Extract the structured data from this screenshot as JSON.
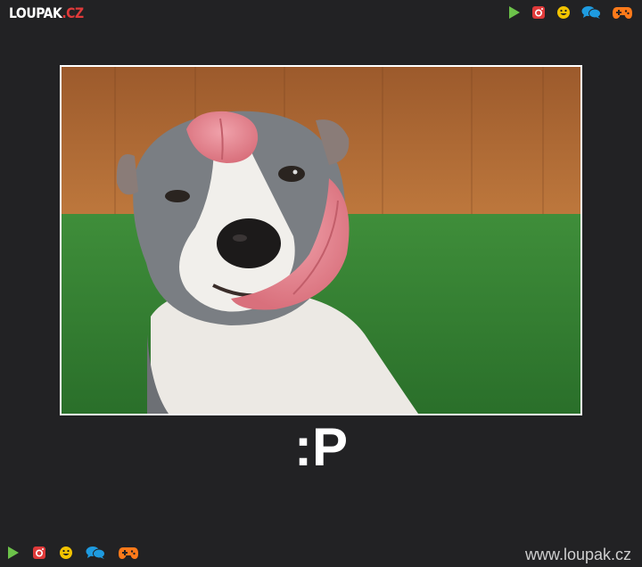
{
  "header": {
    "logo_main": "LOUPAK",
    "logo_tld": ".CZ",
    "icons": [
      "play-icon",
      "instagram-icon",
      "smiley-icon",
      "chat-icon",
      "gamepad-icon"
    ]
  },
  "post": {
    "caption": ":P"
  },
  "footer": {
    "url": "www.loupak.cz",
    "icons": [
      "play-icon",
      "instagram-icon",
      "smiley-icon",
      "chat-icon",
      "gamepad-icon"
    ]
  },
  "colors": {
    "background": "#222224",
    "play": "#6cc24a",
    "instagram": "#e03a3a",
    "smiley": "#f2c300",
    "chat": "#1e9be0",
    "gamepad": "#ff7a1a"
  }
}
